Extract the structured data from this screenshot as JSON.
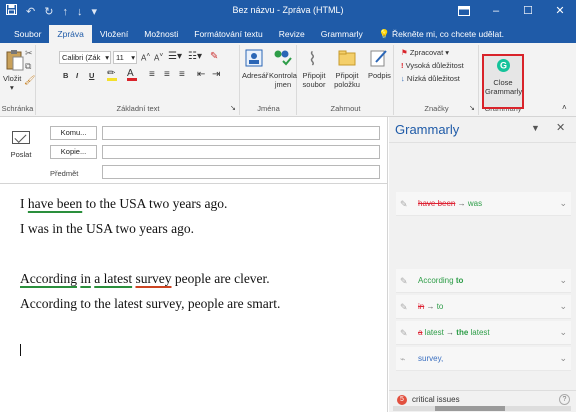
{
  "window": {
    "title": "Bez názvu - Zpráva (HTML)",
    "quick_access": [
      "save-icon",
      "undo-icon",
      "redo-icon",
      "up-arrow-icon",
      "down-arrow-icon",
      "customize-icon"
    ],
    "controls": [
      "ribbon-display-icon",
      "minimize-icon",
      "maximize-icon",
      "close-icon"
    ]
  },
  "tabs": [
    {
      "label": "Soubor"
    },
    {
      "label": "Zpráva",
      "active": true
    },
    {
      "label": "Vložení"
    },
    {
      "label": "Možnosti"
    },
    {
      "label": "Formátování textu"
    },
    {
      "label": "Revize"
    },
    {
      "label": "Grammarly"
    }
  ],
  "tell_me": "Řekněte mi, co chcete udělat.",
  "ribbon": {
    "clipboard": {
      "paste": "Vložit",
      "group": "Schránka"
    },
    "basic_text": {
      "font_name": "Calibri (Zák",
      "font_size": "11",
      "bold": "B",
      "italic": "I",
      "underline": "U",
      "group": "Základní text"
    },
    "names": {
      "address_book": "Adresář",
      "check_names": "Kontrola jmen",
      "group": "Jména"
    },
    "include": {
      "attach_file": "Připojit soubor",
      "attach_item": "Připojit položku",
      "signature": "Podpis",
      "group": "Zahrnout"
    },
    "tags": {
      "follow_up": "Zpracovat",
      "high": "Vysoká důležitost",
      "low": "Nízká důležitost",
      "group": "Značky"
    },
    "grammarly": {
      "close": "Close Grammarly",
      "group": "Grammarly"
    }
  },
  "compose": {
    "send": "Poslat",
    "to": "Komu...",
    "cc": "Kopie...",
    "subject": "Předmět",
    "body": {
      "line1_a": "I ",
      "line1_u": "have been",
      "line1_b": " to the USA two years ago.",
      "line2": "I was in the USA two years ago.",
      "line3_u1": "According",
      "line3_s1": " ",
      "line3_u2": "in",
      "line3_s2": " ",
      "line3_u3": "a latest",
      "line3_s3": " ",
      "line3_u4": "survey",
      "line3_tail": " people are clever.",
      "line4": "According to the latest survey, people are smart."
    }
  },
  "grammarly_panel": {
    "title": "Grammarly",
    "cards": [
      {
        "old": "have been",
        "arrow": "→",
        "new": "was"
      },
      {
        "text": "According",
        "add": "to"
      },
      {
        "old": "in",
        "arrow": "→",
        "new": "to"
      },
      {
        "old": "a",
        "rest": "latest",
        "arrow": "→",
        "new_a": "the",
        "new_b": "latest"
      },
      {
        "text": "survey,"
      }
    ],
    "critical_count": "5",
    "critical_label": "critical issues",
    "help": "?"
  },
  "colors": {
    "brand": "#1f5ba8",
    "ribbon_bg": "#f3f3f3",
    "grammarly_green": "#2e9d48",
    "error_red": "#d23",
    "highlight_border": "#d9232a"
  }
}
